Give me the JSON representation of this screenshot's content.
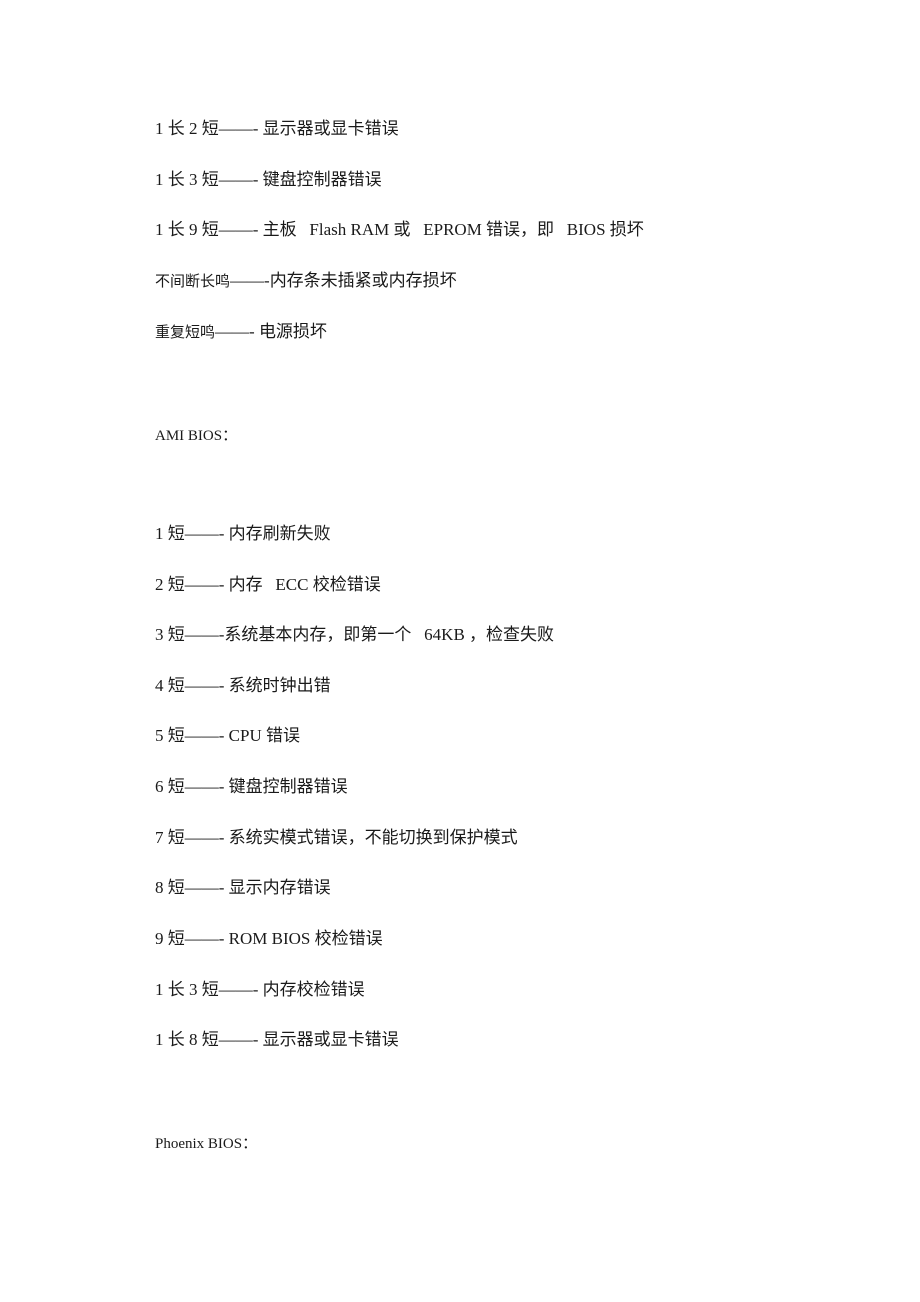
{
  "award_section": {
    "items": [
      {
        "code": "1 长 2 短",
        "sep": "——- ",
        "desc": "显示器或显卡错误"
      },
      {
        "code": "1 长 3 短",
        "sep": "——- ",
        "desc": "键盘控制器错误"
      },
      {
        "code": "1 长 9 短",
        "sep": "——- ",
        "desc": "主板   Flash RAM 或   EPROM 错误，即   BIOS 损坏"
      },
      {
        "code": "不间断长鸣",
        "sep": "——-",
        "desc": "内存条未插紧或内存损坏"
      },
      {
        "code": "重复短鸣",
        "sep": "——- ",
        "desc": "电源损坏"
      }
    ]
  },
  "ami_section": {
    "heading": "AMI BIOS：",
    "items": [
      {
        "code": "1 短",
        "sep": "——- ",
        "desc": "内存刷新失败"
      },
      {
        "code": "2 短",
        "sep": "——- ",
        "desc": "内存   ECC 校检错误"
      },
      {
        "code": "3 短",
        "sep": "——-",
        "desc": "系统基本内存，即第一个   64KB ，检查失败"
      },
      {
        "code": "4 短",
        "sep": "——- ",
        "desc": "系统时钟出错"
      },
      {
        "code": "5 短",
        "sep": "——- ",
        "desc": "CPU 错误"
      },
      {
        "code": "6 短",
        "sep": "——- ",
        "desc": "键盘控制器错误"
      },
      {
        "code": "7 短",
        "sep": "——- ",
        "desc": "系统实模式错误，不能切换到保护模式"
      },
      {
        "code": "8 短",
        "sep": "——- ",
        "desc": "显示内存错误"
      },
      {
        "code": "9 短",
        "sep": "——- ",
        "desc": "ROM BIOS 校检错误"
      },
      {
        "code": "1 长 3 短",
        "sep": "——- ",
        "desc": "内存校检错误"
      },
      {
        "code": "1 长 8 短",
        "sep": "——- ",
        "desc": "显示器或显卡错误"
      }
    ]
  },
  "phoenix_section": {
    "heading": "Phoenix BIOS："
  }
}
